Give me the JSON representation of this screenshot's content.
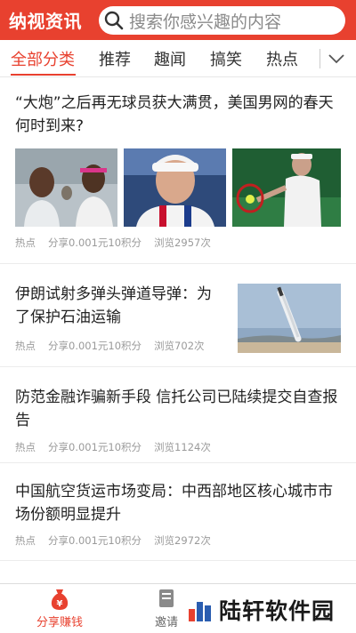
{
  "header": {
    "brand": "纳视资讯",
    "search_placeholder": "搜索你感兴趣的内容"
  },
  "tabs": [
    {
      "label": "全部分类",
      "active": true
    },
    {
      "label": "推荐",
      "active": false
    },
    {
      "label": "趣闻",
      "active": false
    },
    {
      "label": "搞笑",
      "active": false
    },
    {
      "label": "热点",
      "active": false
    }
  ],
  "articles": [
    {
      "title": "“大炮”之后再无球员获大满贯，美国男网的春天何时到来?",
      "category": "热点",
      "share": "分享0.001元10积分",
      "views": "浏览2957次"
    },
    {
      "title": "伊朗试射多弹头弹道导弹：为了保护石油运输",
      "category": "热点",
      "share": "分享0.001元10积分",
      "views": "浏览702次"
    },
    {
      "title": "防范金融诈骗新手段 信托公司已陆续提交自查报告",
      "category": "热点",
      "share": "分享0.001元10积分",
      "views": "浏览1124次"
    },
    {
      "title": "中国航空货运市场变局：中西部地区核心城市市场份额明显提升",
      "category": "热点",
      "share": "分享0.001元10积分",
      "views": "浏览2972次"
    }
  ],
  "bottom_nav": [
    {
      "label": "分享赚钱",
      "icon": "money-bag-icon",
      "active": true
    },
    {
      "label": "邀请",
      "icon": "invite-icon",
      "active": false
    }
  ],
  "watermark": "陆轩软件园",
  "colors": {
    "accent": "#e8412f",
    "meta": "#9a9a9a"
  }
}
